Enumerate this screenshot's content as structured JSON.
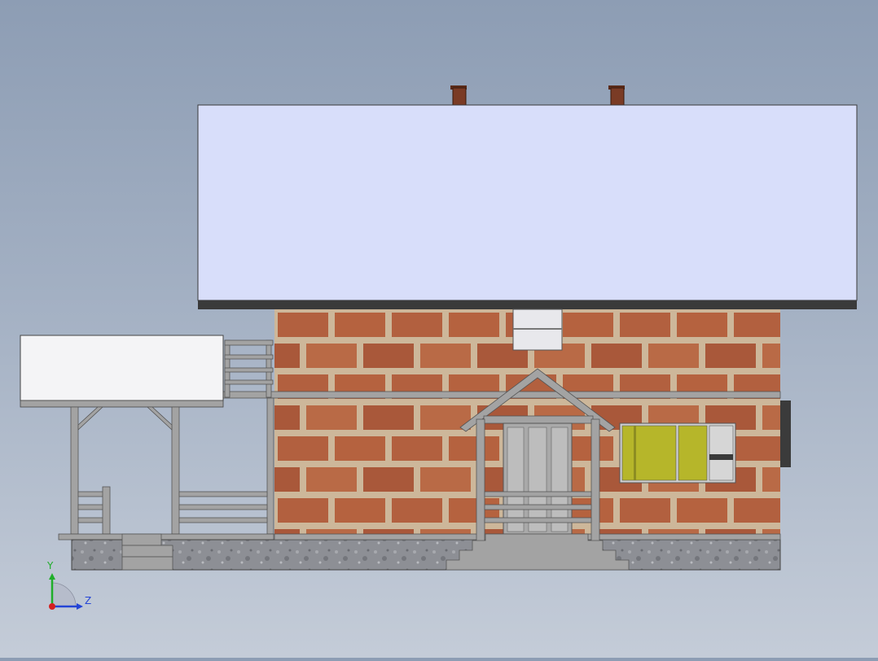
{
  "viewport": {
    "background_top": "#8d9db4",
    "background_bottom": "#c4ccd8"
  },
  "model": {
    "roof_color": "#d8defa",
    "roof_edge_color": "#3a3a3a",
    "brick_color": "#b2603f",
    "mortar_color": "#cdb79a",
    "foundation_color": "#8d8f95",
    "porch_roof_color": "#f4f4f6",
    "trim_color": "#a3a3a3",
    "chimney_color": "#7a3b25",
    "window_highlight_color": "#b6b62a"
  },
  "triad": {
    "y_label": "Y",
    "z_label": "Z",
    "y_color": "#1fae2a",
    "z_color": "#2444d6",
    "x_color": "#d42020"
  }
}
